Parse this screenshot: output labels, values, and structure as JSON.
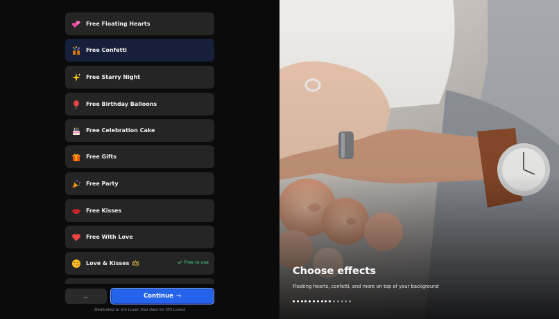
{
  "effects": [
    {
      "label": "Free Floating Hearts",
      "icon": "double-hearts-icon"
    },
    {
      "label": "Free Confetti",
      "icon": "confetti-icon",
      "selected": true
    },
    {
      "label": "Free Starry Night",
      "icon": "sparkles-icon"
    },
    {
      "label": "Free Birthday Balloons",
      "icon": "balloon-icon"
    },
    {
      "label": "Free Celebration Cake",
      "icon": "cake-icon"
    },
    {
      "label": "Free Gifts",
      "icon": "gift-icon"
    },
    {
      "label": "Free Party",
      "icon": "party-popper-icon"
    },
    {
      "label": "Free Kisses",
      "icon": "lips-icon"
    },
    {
      "label": "Free With Love",
      "icon": "red-heart-icon"
    },
    {
      "label": "Love & Kisses",
      "icon": "kissing-face-icon",
      "premium_icon": "crown-icon",
      "badge": "Free to use"
    }
  ],
  "nav": {
    "back_glyph": "←",
    "continue_label": "Continue",
    "continue_glyph": "→"
  },
  "dedication": "Dedicated to the Lover that died for HIS Loved",
  "onboarding": {
    "title": "Choose effects",
    "subtitle": "Floating hearts, confetti, and more on top of your background",
    "steps_total": 15,
    "steps_completed": 10
  },
  "colors": {
    "accent": "#2563eb",
    "item_bg": "#252526",
    "selected_bg": "#16203a",
    "badge_green": "#4ade80",
    "page_bg": "#0b0b0c"
  }
}
